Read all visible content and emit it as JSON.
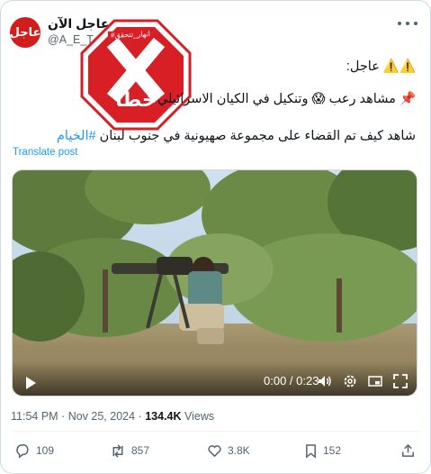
{
  "author": {
    "avatar_text": "عاجل",
    "display_name": "عاجل الآن",
    "handle": "@A_E_T_er"
  },
  "stamp": {
    "word": "خطأ",
    "tag": "#انهار_تتحقق",
    "color": "#d81f26"
  },
  "post": {
    "line1": "⚠️⚠️ عاجل:",
    "line2": "📌 مشاهد رعب 😱 وتنكيل في الكيان الاسرائيلي",
    "line3_text": "شاهد كيف تم القضاء على مجموعة صهيونية في جنوب لبنان ",
    "line3_hashtag": "#الخيام",
    "translate_label": "Translate post"
  },
  "video": {
    "timecode": "0:00 / 0:23"
  },
  "meta": {
    "time": "11:54 PM",
    "date": "Nov 25, 2024",
    "views_count": "134.4K",
    "views_label": "Views"
  },
  "actions": {
    "replies": "109",
    "reposts": "857",
    "likes": "3.8K",
    "bookmarks": "152"
  },
  "colors": {
    "accent": "#1d9bf0",
    "text": "#0f1419",
    "muted": "#536471",
    "avatar_bg": "#d31d1d"
  }
}
